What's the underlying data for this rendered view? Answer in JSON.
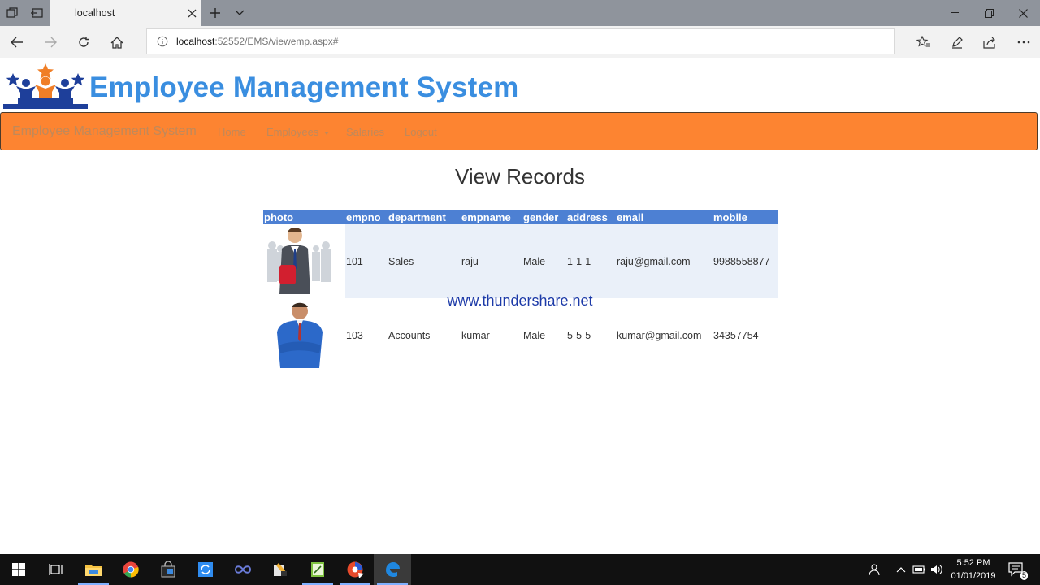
{
  "browser": {
    "tab_title": "localhost",
    "url_host": "localhost",
    "url_rest": ":52552/EMS/viewemp.aspx#"
  },
  "header": {
    "title": "Employee Management System"
  },
  "navbar": {
    "brand": "Employee Management System",
    "links": [
      "Home",
      "Employees",
      "Salaries",
      "Logout"
    ]
  },
  "main": {
    "heading": "View Records",
    "table": {
      "columns": [
        "photo",
        "empno",
        "department",
        "empname",
        "gender",
        "address",
        "email",
        "mobile"
      ],
      "rows": [
        {
          "empno": "101",
          "department": "Sales",
          "empname": "raju",
          "gender": "Male",
          "address": "1-1-1",
          "email": "raju@gmail.com",
          "mobile": "9988558877"
        },
        {
          "empno": "103",
          "department": "Accounts",
          "empname": "kumar",
          "gender": "Male",
          "address": "5-5-5",
          "email": "kumar@gmail.com",
          "mobile": "34357754"
        }
      ]
    },
    "watermark": "www.thundershare.net"
  },
  "taskbar": {
    "time": "5:52 PM",
    "date": "01/01/2019",
    "notifications": "5"
  },
  "colors": {
    "title_blue": "#3a8ee0",
    "navbar_orange": "#fd8431",
    "table_header": "#4d80d3",
    "row_stripe": "#eaf0f9"
  }
}
